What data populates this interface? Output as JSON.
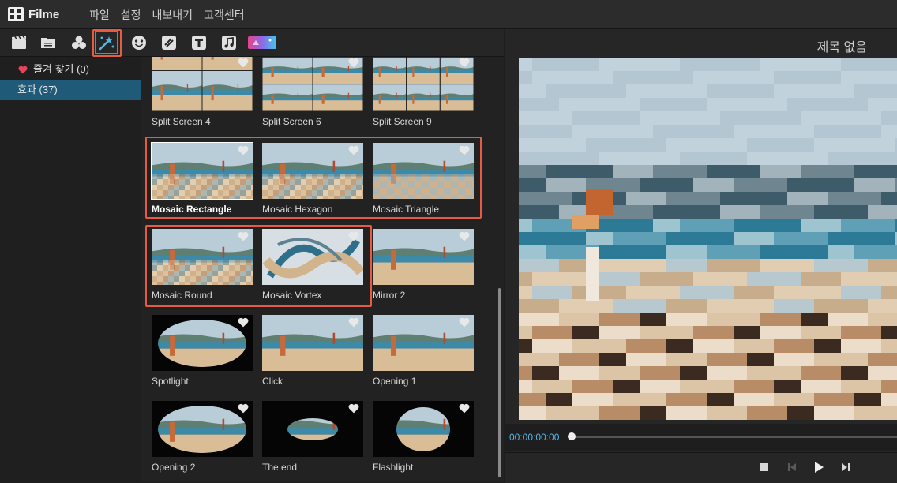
{
  "app": {
    "name": "Filme"
  },
  "menu": {
    "items": [
      "파일",
      "설정",
      "내보내기",
      "고객센터"
    ]
  },
  "toolbar": {
    "tools": [
      {
        "name": "media-icon"
      },
      {
        "name": "folder-icon"
      },
      {
        "name": "filters-icon"
      },
      {
        "name": "effects-icon",
        "active": true
      },
      {
        "name": "sticker-face-icon"
      },
      {
        "name": "transition-icon"
      },
      {
        "name": "text-icon"
      },
      {
        "name": "music-icon"
      },
      {
        "name": "gradient-overlay-icon"
      }
    ]
  },
  "categories": {
    "favorites": "즐겨 찾기 (0)",
    "effects": "효과 (37)"
  },
  "effects": [
    {
      "label": "Split Screen 4"
    },
    {
      "label": "Split Screen 6"
    },
    {
      "label": "Split Screen 9"
    },
    {
      "label": "Mosaic Rectangle"
    },
    {
      "label": "Mosaic Hexagon"
    },
    {
      "label": "Mosaic Triangle"
    },
    {
      "label": "Mosaic Round"
    },
    {
      "label": "Mosaic Vortex"
    },
    {
      "label": "Mirror 2"
    },
    {
      "label": "Spotlight"
    },
    {
      "label": "Click"
    },
    {
      "label": "Opening 1"
    },
    {
      "label": "Opening 2"
    },
    {
      "label": "The end"
    },
    {
      "label": "Flashlight"
    }
  ],
  "preview": {
    "title": "제목 없음",
    "timecode": "00:00:00:00"
  },
  "colors": {
    "accent_highlight": "#e85b43",
    "selection": "#1f5a78",
    "timecode": "#5ab4e6",
    "heart": "#e8435c"
  }
}
